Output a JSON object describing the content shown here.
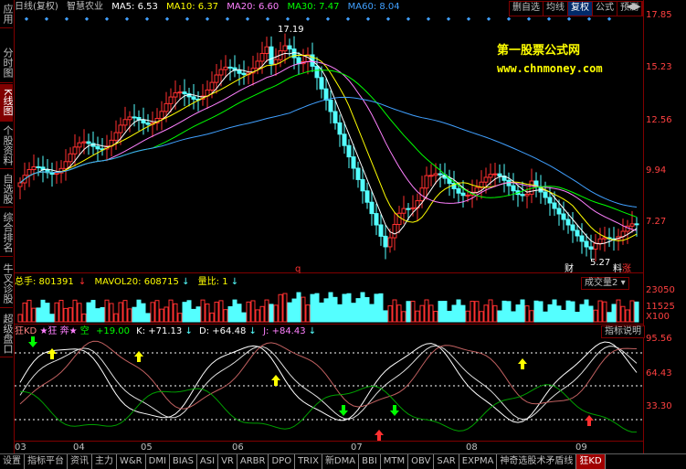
{
  "sidebar": {
    "tabs": [
      {
        "label": "应用",
        "active": false
      },
      {
        "label": "分时图",
        "active": false
      },
      {
        "label": "K线图",
        "active": true
      },
      {
        "label": "个股资料",
        "active": false
      },
      {
        "label": "自选股",
        "active": false
      },
      {
        "label": "综合排名",
        "active": false
      },
      {
        "label": "牛叉诊股",
        "active": false
      },
      {
        "label": "超级盘口",
        "active": false
      }
    ]
  },
  "header": {
    "chart_mode": "日线(复权)",
    "stock_name": "智慧农业",
    "ma5": "MA5: 6.53",
    "ma10": "MA10: 6.37",
    "ma20": "MA20: 6.60",
    "ma30": "MA30: 7.47",
    "ma60": "MA60: 8.04",
    "toolbar": [
      "删自选",
      "均线",
      "复权",
      "公式",
      "预测"
    ]
  },
  "watermark": {
    "line1": "第一股票公式网",
    "line2": "www.chnmoney.com"
  },
  "price_axis": [
    "17.85",
    "15.23",
    "12.56",
    "9.94",
    "7.27"
  ],
  "annotations": {
    "high": "17.19",
    "low": "5.27",
    "cai": "财",
    "liao": "料",
    "zhang": "涨",
    "q": "q"
  },
  "volume": {
    "hand": "总手: 801391",
    "mavol": "MAVOL20: 608715",
    "ratio": "量比: 1",
    "button": "成交量2",
    "axis": [
      "23050",
      "11525",
      "X100"
    ]
  },
  "indicator": {
    "name": "狂KD",
    "kuang": "★狂",
    "ben": "奔★",
    "kong": "空",
    "val1": "+19.00",
    "k": "K: +71.13",
    "d": "D: +64.48",
    "j": "J: +84.43",
    "button": "指标说明",
    "axis": [
      "95.56",
      "64.43",
      "33.30"
    ]
  },
  "dates": [
    "03",
    "04",
    "05",
    "06",
    "07",
    "08",
    "09"
  ],
  "bottom_tabs": [
    "设置",
    "指标平台",
    "资讯",
    "主力",
    "W&R",
    "DMI",
    "BIAS",
    "ASI",
    "VR",
    "ARBR",
    "DPO",
    "TRIX",
    "新DMA",
    "BBI",
    "MTM",
    "OBV",
    "SAR",
    "EXPMA",
    "神奇选股术矛盾线",
    "狂KD"
  ],
  "colors": {
    "up": "#ff3030",
    "down": "#54ffff",
    "ma5": "#ffffff",
    "ma10": "#ffff00",
    "ma20": "#ff80ff",
    "ma30": "#00ff00",
    "ma60": "#40a0ff",
    "frame": "#800000"
  }
}
